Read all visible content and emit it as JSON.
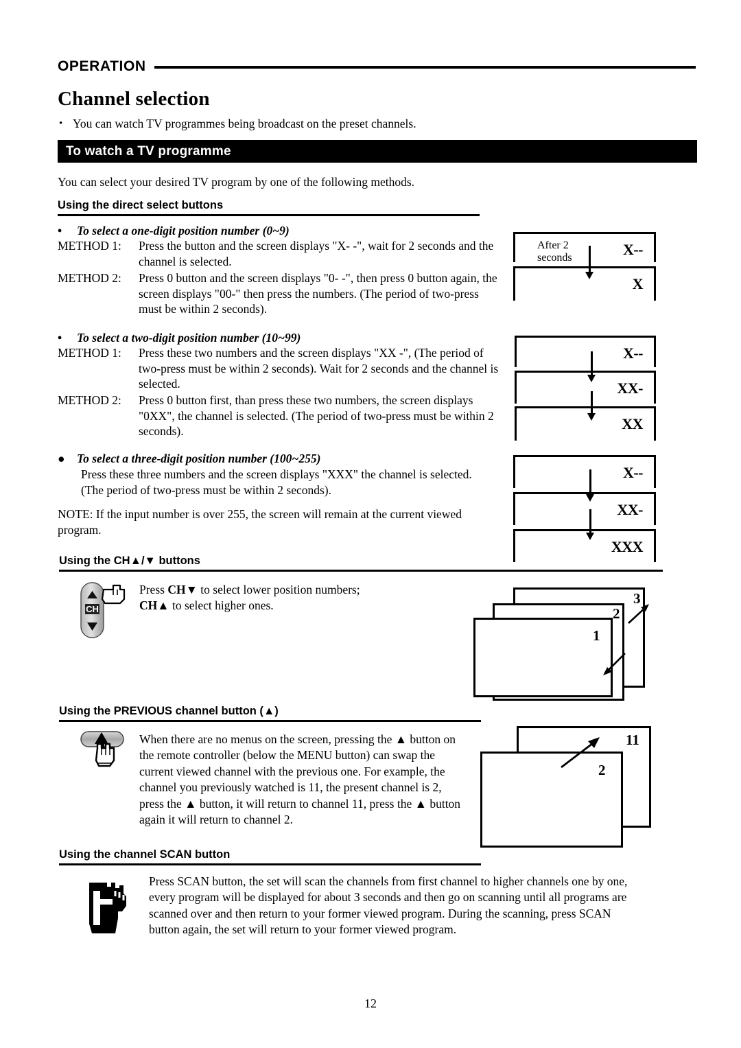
{
  "running_head": {
    "title": "OPERATION"
  },
  "chapter": {
    "title": "Channel selection"
  },
  "intro": {
    "bullet_marker": "•",
    "text": "You can watch TV programmes being broadcast on the preset channels."
  },
  "banner": {
    "title": "To watch a TV programme"
  },
  "lead_paragraph": "You can select your desired TV program by one of the following methods.",
  "sections": {
    "direct_select": {
      "heading": "Using the direct select buttons",
      "one_digit": {
        "bullet_marker": "•",
        "title": "To select a one-digit position number (0~9)",
        "method1_label": "METHOD 1:",
        "method1_text": "Press the button and the screen displays \"X- -\", wait for 2 seconds and the channel is selected.",
        "method2_label": "METHOD 2:",
        "method2_text": "Press 0 button and the screen displays \"0- -\", then press 0 button again, the screen displays \"00-\" then press the numbers. (The period of two-press must be within 2 seconds)."
      },
      "two_digit": {
        "bullet_marker": "•",
        "title": "To select a two-digit position number (10~99)",
        "method1_label": "METHOD 1:",
        "method1_text": "Press these two numbers and the screen displays \"XX -\", (The period of two-press must be within 2 seconds). Wait for 2 seconds and the channel is selected.",
        "method2_label": "METHOD 2:",
        "method2_text": "Press 0 button first, than press these two numbers, the screen displays \"0XX\", the channel is selected. (The period of two-press must be within 2 seconds)."
      },
      "three_digit": {
        "bullet_marker": "●",
        "title": "To select a three-digit position number (100~255)",
        "body": "Press these three numbers and the screen displays \"XXX\" the channel is selected. (The period of two-press must be within 2 seconds)."
      },
      "note": "NOTE: If the input number is over 255, the screen will remain at the current viewed program."
    },
    "ch_buttons": {
      "heading_prefix": "Using the CH",
      "heading_up": "▲",
      "heading_slash": "/",
      "heading_down": "▼",
      "heading_suffix": " buttons",
      "body_line1_a": "Press ",
      "body_line1_b": "CH",
      "body_line1_c": "▼",
      "body_line1_d": " to select lower position numbers;",
      "body_line2_a": "CH",
      "body_line2_b": "▲",
      "body_line2_c": " to select higher ones.",
      "icon_label": "CH",
      "icon_up": "▲",
      "icon_down": "▼"
    },
    "previous_channel": {
      "heading_prefix": "Using the PREVIOUS channel button (",
      "heading_triangle": "▲",
      "heading_suffix": ")",
      "body_1": "When there are no menus on the screen, pressing the ",
      "tri": "▲",
      "body_2": " button on the remote controller (below the MENU button) can swap the  current viewed channel with the previous one. For example, the channel you previously watched is 11, the present channel is 2, press the ",
      "body_3": " button, it will return to channel 11, press the ",
      "body_4": " button again it will return to channel 2."
    },
    "scan_button": {
      "heading": "Using the channel SCAN button",
      "body": "Press SCAN button, the set will scan the channels from first channel to higher channels one by one, every program will be displayed for about 3 seconds and then go on scanning until all programs are scanned over and then return to  your former viewed program. During the scanning, press SCAN button again, the set will return to your former viewed program."
    }
  },
  "diagrams": {
    "one_digit": {
      "after_label_line1": "After 2",
      "after_label_line2": "seconds",
      "screens": [
        "X--",
        "X"
      ]
    },
    "two_digit": {
      "screens": [
        "X--",
        "XX-",
        "XX"
      ]
    },
    "three_digit": {
      "screens": [
        "X--",
        "XX-",
        "XXX"
      ]
    },
    "ch_stack": {
      "panes": [
        "3",
        "2",
        "1"
      ]
    },
    "prev_stack": {
      "panes": [
        "11",
        "2"
      ]
    }
  },
  "footer": {
    "page_number": "12"
  }
}
